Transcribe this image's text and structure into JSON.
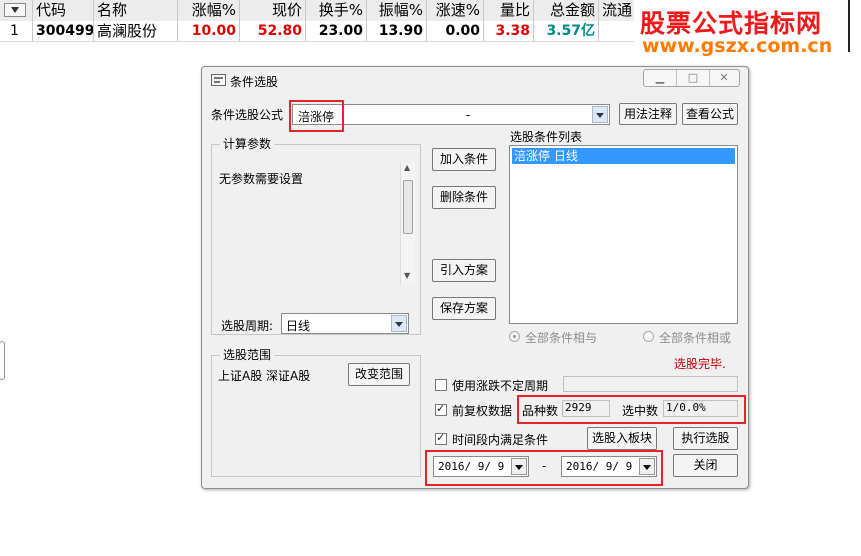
{
  "grid": {
    "headers": [
      "代码",
      "名称",
      "涨幅%",
      "现价",
      "换手%",
      "振幅%",
      "涨速%",
      "量比",
      "总金额",
      "流通"
    ],
    "row": {
      "index": "1",
      "code": "300499",
      "name": "高澜股份",
      "change_pct": "10.00",
      "price": "52.80",
      "turnover": "23.00",
      "amplitude": "13.90",
      "speed": "0.00",
      "volume_ratio": "3.38",
      "amount": "3.57亿"
    }
  },
  "watermark": {
    "line1": "股票公式指标网",
    "line2": "www.gszx.com.cn"
  },
  "dialog": {
    "title": "条件选股",
    "formula_label": "条件选股公式",
    "formula_value": "涪涨停",
    "formula_desc": "-",
    "btn_usage": "用法注释",
    "btn_view": "查看公式",
    "params_group": "计算参数",
    "params_text": "无参数需要设置",
    "period_label": "选股周期:",
    "period_value": "日线",
    "btn_add": "加入条件",
    "btn_delete": "删除条件",
    "btn_import": "引入方案",
    "btn_save": "保存方案",
    "cond_list_label": "选股条件列表",
    "cond_items": [
      "涪涨停  日线"
    ],
    "radio_and": "全部条件相与",
    "radio_or": "全部条件相或",
    "status": "选股完毕.",
    "range_group": "选股范围",
    "range_text": "上证A股 深证A股",
    "btn_range": "改变范围",
    "chk_period": "使用涨跌不定周期",
    "chk_adjust": "前复权数据",
    "count_label": "品种数",
    "count_value": "2929",
    "selected_label": "选中数",
    "selected_value": "1/0.0%",
    "chk_timespan": "时间段内满足条件",
    "btn_to_block": "选股入板块",
    "btn_execute": "执行选股",
    "date_from": "2016/ 9/ 9",
    "date_sep": "-",
    "date_to": "2016/ 9/ 9",
    "btn_close": "关闭"
  },
  "colors": {
    "red": "#e00000",
    "green": "#008a8a",
    "highlight": "#3399ff",
    "annotation": "#e8232a"
  }
}
